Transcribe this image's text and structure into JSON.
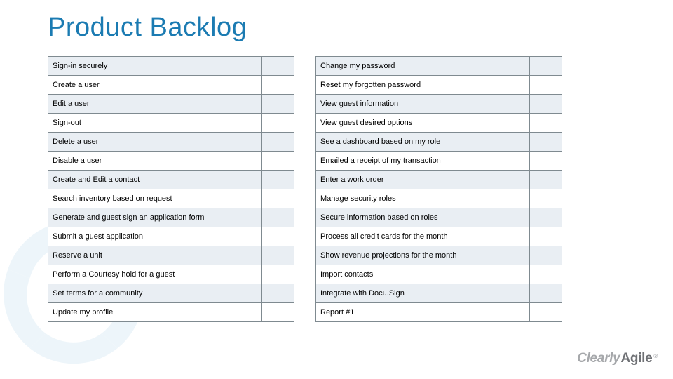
{
  "title": "Product Backlog",
  "left_items": [
    "Sign-in securely",
    "Create a user",
    "Edit a user",
    "Sign-out",
    "Delete a user",
    "Disable a user",
    "Create and Edit a contact",
    "Search inventory based on request",
    "Generate and guest sign an application form",
    "Submit a guest application",
    "Reserve a unit",
    "Perform a Courtesy hold for a guest",
    "Set terms for a community",
    "Update my profile"
  ],
  "right_items": [
    "Change my password",
    "Reset my forgotten password",
    "View guest information",
    "View guest desired options",
    "See a dashboard based on my role",
    "Emailed a receipt of my transaction",
    "Enter a work order",
    "Manage security roles",
    "Secure information based on roles",
    "Process all credit cards for the month",
    "Show revenue projections for the month",
    "Import contacts",
    "Integrate with Docu.Sign",
    "Report #1"
  ],
  "logo": {
    "part1": "Clearly",
    "part2": "Agile",
    "reg": "®"
  }
}
